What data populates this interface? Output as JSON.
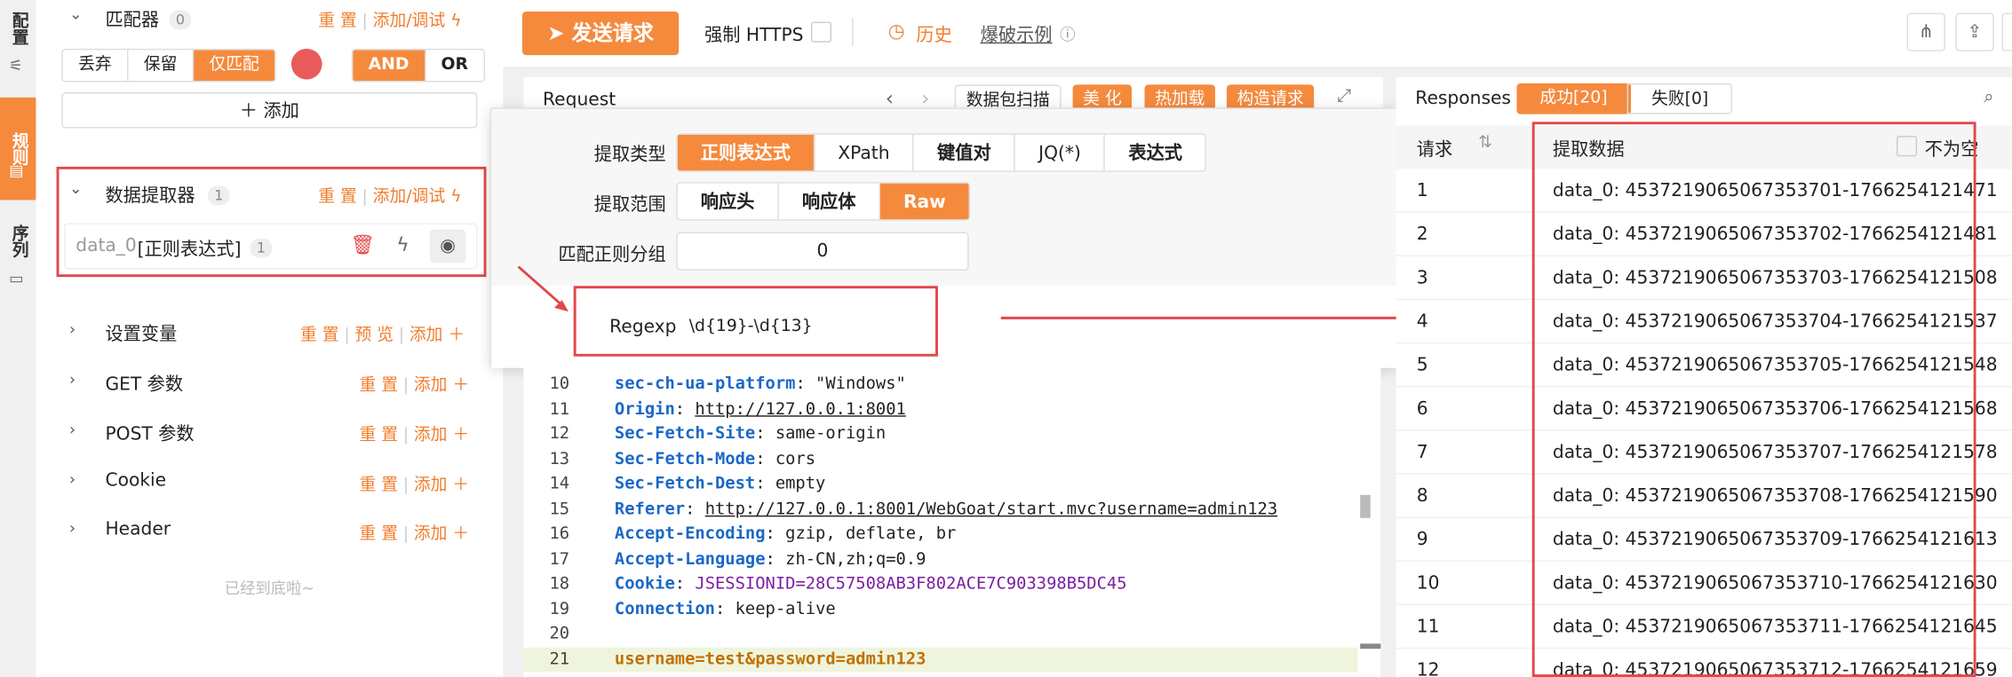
{
  "left_tabs": [
    "配置",
    "规则",
    "序列"
  ],
  "matcher": {
    "title": "匹配器",
    "count": "0",
    "reset": "重 置",
    "add_debug": "添加/调试",
    "mode_options": [
      "丢弃",
      "保留",
      "仅匹配"
    ],
    "selected_mode": "仅匹配",
    "logic_options": [
      "AND",
      "OR"
    ],
    "selected_logic": "AND",
    "add_label": "添加"
  },
  "extractor": {
    "title": "数据提取器",
    "count": "1",
    "reset": "重 置",
    "add_debug": "添加/调试",
    "item_name": "data_0",
    "item_type": "[正则表达式]",
    "item_count": "1"
  },
  "sections": [
    {
      "label": "设置变量",
      "reset": "重 置",
      "preview": "预 览",
      "add": "添加"
    },
    {
      "label": "GET 参数",
      "reset": "重 置",
      "add": "添加"
    },
    {
      "label": "POST 参数",
      "reset": "重 置",
      "add": "添加"
    },
    {
      "label": "Cookie",
      "reset": "重 置",
      "add": "添加"
    },
    {
      "label": "Header",
      "reset": "重 置",
      "add": "添加"
    }
  ],
  "bottom_hint": "已经到底啦~",
  "toolbar": {
    "send_label": "发送请求",
    "https_label": "强制 HTTPS",
    "history_label": "历史",
    "example_label": "爆破示例"
  },
  "request_panel": {
    "title": "Request",
    "scan_label": "数据包扫描",
    "beautify": "美 化",
    "hot_load": "热加载",
    "construct": "构造请求"
  },
  "popup": {
    "extract_type_label": "提取类型",
    "extract_types": [
      "正则表达式",
      "XPath",
      "键值对",
      "JQ(*)",
      "表达式"
    ],
    "selected_type": "正则表达式",
    "range_label": "提取范围",
    "ranges": [
      "响应头",
      "响应体",
      "Raw"
    ],
    "selected_range": "Raw",
    "group_label": "匹配正则分组",
    "group_value": "0",
    "regexp_label": "Regexp",
    "regexp_value": "\\d{19}-\\d{13}"
  },
  "code_lines": [
    {
      "n": "10",
      "key": "sec-ch-ua-platform",
      "val": "\"Windows\""
    },
    {
      "n": "11",
      "key": "Origin",
      "val": "http://127.0.0.1:8001"
    },
    {
      "n": "12",
      "key": "Sec-Fetch-Site",
      "val": "same-origin"
    },
    {
      "n": "13",
      "key": "Sec-Fetch-Mode",
      "val": "cors"
    },
    {
      "n": "14",
      "key": "Sec-Fetch-Dest",
      "val": "empty"
    },
    {
      "n": "15",
      "key": "Referer",
      "val": "http://127.0.0.1:8001/WebGoat/start.mvc?username=admin123"
    },
    {
      "n": "16",
      "key": "Accept-Encoding",
      "val": "gzip, deflate, br"
    },
    {
      "n": "17",
      "key": "Accept-Language",
      "val": "zh-CN,zh;q=0.9"
    },
    {
      "n": "18",
      "key": "Cookie",
      "val": "JSESSIONID=28C57508AB3F802ACE7C903398B5DC45"
    },
    {
      "n": "19",
      "key": "Connection",
      "val": "keep-alive"
    },
    {
      "n": "20",
      "key": "",
      "val": ""
    },
    {
      "n": "21",
      "key": "",
      "val": "username=test&password=admin123"
    }
  ],
  "responses": {
    "title": "Responses",
    "success_tab": "成功[20]",
    "fail_tab": "失败[0]",
    "col_request": "请求",
    "col_data": "提取数据",
    "not_empty_label": "不为空",
    "rows": [
      {
        "n": "1",
        "data": "data_0: 4537219065067353701-1766254121471"
      },
      {
        "n": "2",
        "data": "data_0: 4537219065067353702-1766254121481"
      },
      {
        "n": "3",
        "data": "data_0: 4537219065067353703-1766254121508"
      },
      {
        "n": "4",
        "data": "data_0: 4537219065067353704-1766254121537"
      },
      {
        "n": "5",
        "data": "data_0: 4537219065067353705-1766254121548"
      },
      {
        "n": "6",
        "data": "data_0: 4537219065067353706-1766254121568"
      },
      {
        "n": "7",
        "data": "data_0: 4537219065067353707-1766254121578"
      },
      {
        "n": "8",
        "data": "data_0: 4537219065067353708-1766254121590"
      },
      {
        "n": "9",
        "data": "data_0: 4537219065067353709-1766254121613"
      },
      {
        "n": "10",
        "data": "data_0: 4537219065067353710-1766254121630"
      },
      {
        "n": "11",
        "data": "data_0: 4537219065067353711-1766254121645"
      },
      {
        "n": "12",
        "data": "data_0: 4537219065067353712-1766254121659"
      }
    ]
  },
  "colors": {
    "accent": "#f58a3d",
    "highlight_box": "#e3474b",
    "link_blue": "#1a68c7"
  }
}
